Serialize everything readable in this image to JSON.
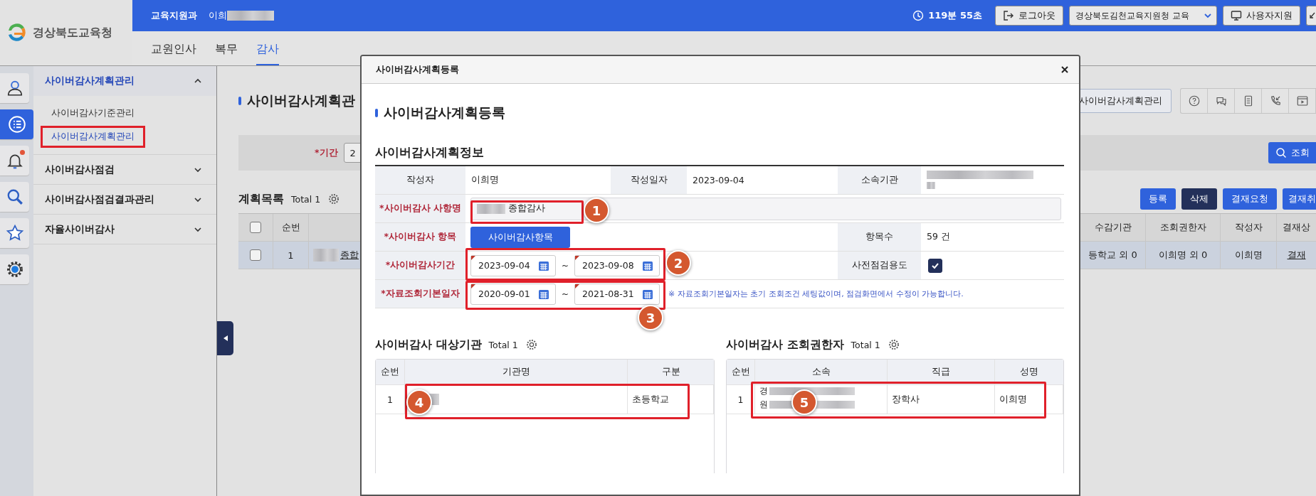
{
  "header": {
    "logo": "경상북도교육청",
    "department": "교육지원과",
    "user": "이희",
    "timer": "119분 55초",
    "logout": "로그아웃",
    "org_select": "경상북도김천교육지원청 교육",
    "support": "사용자지원"
  },
  "nav_tabs": [
    {
      "label": "교원인사",
      "selected": false
    },
    {
      "label": "복무",
      "selected": false
    },
    {
      "label": "감사",
      "selected": true
    }
  ],
  "rail": [
    {
      "kind": "person",
      "selected": false,
      "badge": false
    },
    {
      "kind": "list",
      "selected": true,
      "badge": false
    },
    {
      "kind": "bell",
      "selected": false,
      "badge": true
    },
    {
      "kind": "search",
      "selected": false,
      "badge": false
    },
    {
      "kind": "star",
      "selected": false,
      "badge": false
    },
    {
      "kind": "gear",
      "selected": false,
      "badge": false
    }
  ],
  "sidebar": [
    {
      "label": "사이버감사계획관리",
      "expanded": true,
      "children": [
        {
          "label": "사이버감사기준관리",
          "selected": false,
          "highlighted": false
        },
        {
          "label": "사이버감사계획관리",
          "selected": true,
          "highlighted": true
        }
      ]
    },
    {
      "label": "사이버감사점검",
      "expanded": false
    },
    {
      "label": "사이버감사점검결과관리",
      "expanded": false
    },
    {
      "label": "자율사이버감사",
      "expanded": false
    }
  ],
  "page": {
    "title": "사이버감사계획관",
    "breadcrumb": "사이버감사계획관리",
    "toolbar": [
      {
        "kind": "help"
      },
      {
        "kind": "chat"
      },
      {
        "kind": "document"
      },
      {
        "kind": "phone"
      },
      {
        "kind": "video"
      }
    ],
    "search": {
      "label": "*기간",
      "value": "2",
      "button": "조회"
    },
    "list": {
      "title": "계획목록",
      "total": "Total 1",
      "buttons": [
        {
          "label": "등록",
          "kind": "primary"
        },
        {
          "label": "삭제",
          "kind": "dark"
        },
        {
          "label": "결재요청",
          "kind": "primary"
        },
        {
          "label": "결재취",
          "kind": "primary"
        }
      ],
      "header_checked": false,
      "columns_left": [
        "순번"
      ],
      "columns_right": [
        "수감기관",
        "조회권한자",
        "작성자",
        "결재상"
      ],
      "rows": [
        {
          "selected": true,
          "checked": false,
          "no": "1",
          "subject": "종합",
          "cells_right": [
            "등학교 외 0",
            "이희명 외 0",
            "이희명"
          ],
          "status": "결재"
        }
      ]
    }
  },
  "modal": {
    "title": "사이버감사계획등록",
    "heading": "사이버감사계획등록",
    "section": "사이버감사계획정보",
    "info": {
      "author_label": "작성자",
      "author": "이희명",
      "date_label": "작성일자",
      "date": "2023-09-04",
      "org_label": "소속기관"
    },
    "subject": {
      "label": "*사이버감사 사항명",
      "value": "종합감사",
      "annotation": "1"
    },
    "items": {
      "label": "*사이버감사 항목",
      "button": "사이버감사항목",
      "count_label": "항목수",
      "count": "59 건"
    },
    "period": {
      "label": "*사이버감사기간",
      "from": "2023-09-04",
      "separator": "~",
      "to": "2023-09-08",
      "annotation": "2",
      "precheck_label": "사전점검용도",
      "precheck_checked": true
    },
    "base_dates": {
      "label": "*자료조회기본일자",
      "from": "2020-09-01",
      "separator": "~",
      "to": "2021-08-31",
      "annotation": "3",
      "note": "※ 자료조회기본일자는 초기 조회조건 세팅값이며, 점검화면에서 수정이 가능합니다."
    },
    "targets": {
      "title": "사이버감사 대상기관",
      "total": "Total 1",
      "columns": [
        "순번",
        "기관명",
        "구분"
      ],
      "rows": [
        {
          "no": "1",
          "type": "초등학교",
          "annotation": "4"
        }
      ]
    },
    "viewers": {
      "title": "사이버감사 조회권한자",
      "total": "Total 1",
      "columns": [
        "순번",
        "소속",
        "직급",
        "성명"
      ],
      "rows": [
        {
          "no": "1",
          "org_lines": [
            "경",
            "원"
          ],
          "rank": "장학사",
          "name": "이희명",
          "annotation": "5"
        }
      ]
    }
  }
}
